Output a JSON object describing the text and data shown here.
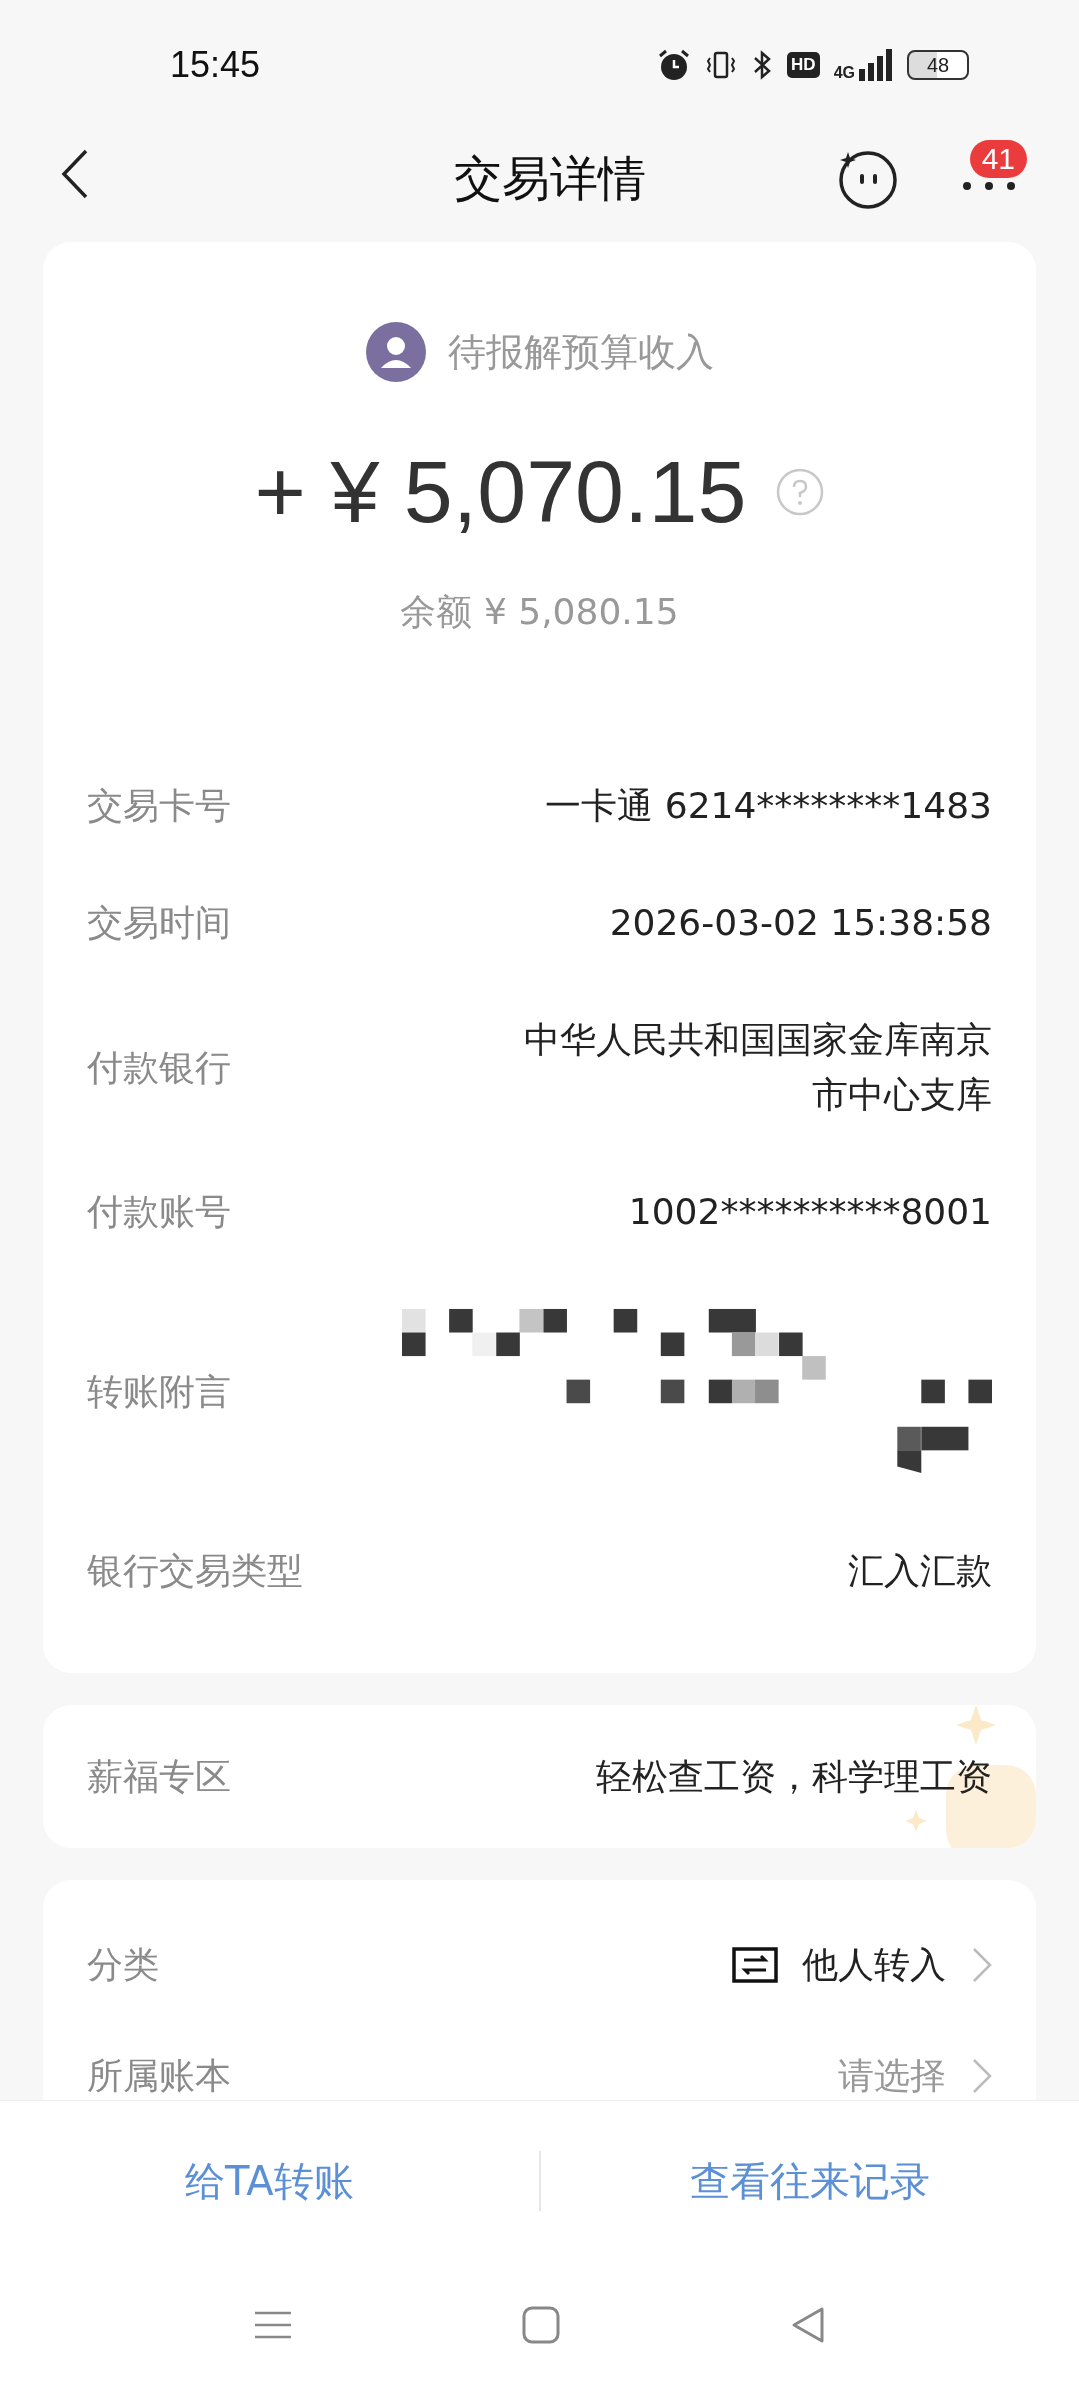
{
  "status_bar": {
    "time": "15:45",
    "hd": "HD",
    "network": "4G",
    "battery": "48"
  },
  "header": {
    "title": "交易详情",
    "badge": "41"
  },
  "summary": {
    "status": "待报解预算收入",
    "amount": "+ ¥ 5,070.15",
    "balance": "余额 ¥ 5,080.15"
  },
  "details": [
    {
      "label": "交易卡号",
      "kind": "text",
      "value": "一卡通 6214********1483"
    },
    {
      "label": "交易时间",
      "kind": "text",
      "value": "2026-03-02 15:38:58"
    },
    {
      "label": "付款银行",
      "kind": "text",
      "value": "中华人民共和国国家金库南京市中心支库"
    },
    {
      "label": "付款账号",
      "kind": "text",
      "value": "1002**********8001"
    },
    {
      "label": "转账附言",
      "kind": "redacted"
    },
    {
      "label": "银行交易类型",
      "kind": "text",
      "value": "汇入汇款"
    }
  ],
  "salary": {
    "label": "薪福专区",
    "value": "轻松查工资，科学理工资"
  },
  "settings": [
    {
      "label": "分类",
      "kind": "category",
      "value": "他人转入"
    },
    {
      "label": "所属账本",
      "kind": "select",
      "placeholder": "请选择"
    }
  ],
  "actions": [
    "给TA转账",
    "查看往来记录"
  ]
}
